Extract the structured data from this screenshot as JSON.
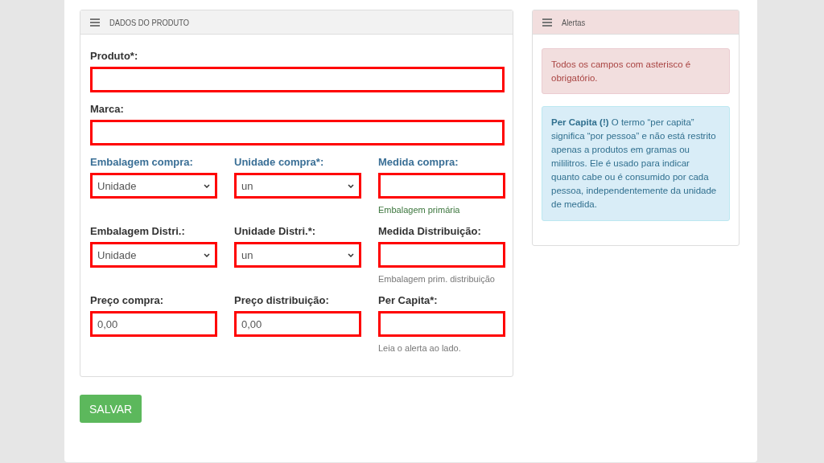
{
  "product_panel": {
    "title": "DADOS DO PRODUTO",
    "rows": [
      {
        "fields": [
          {
            "label": "Produto*:",
            "kind": "input",
            "highlighted": false,
            "invalid": true
          }
        ]
      },
      {
        "fields": [
          {
            "label": "Marca:",
            "kind": "input",
            "highlighted": false,
            "invalid": true
          }
        ]
      },
      {
        "fields": [
          {
            "label": "Embalagem compra:",
            "kind": "select",
            "value": "Unidade",
            "highlighted": true,
            "invalid": true
          },
          {
            "label": "Unidade compra*:",
            "kind": "select",
            "value": "un",
            "highlighted": true,
            "invalid": true
          },
          {
            "label": "Medida compra:",
            "kind": "input",
            "highlighted": true,
            "invalid": true,
            "help": {
              "text": "Embalagem primária",
              "color": "#3c763d"
            }
          }
        ]
      },
      {
        "fields": [
          {
            "label": "Embalagem Distri.:",
            "kind": "select",
            "value": "Unidade",
            "highlighted": false,
            "invalid": true
          },
          {
            "label": "Unidade Distri.*:",
            "kind": "select",
            "value": "un",
            "highlighted": false,
            "invalid": true
          },
          {
            "label": "Medida Distribuição:",
            "kind": "input",
            "highlighted": false,
            "invalid": true,
            "help": {
              "text": "Embalagem prim. distribuição",
              "color": "#777777"
            }
          }
        ]
      },
      {
        "fields": [
          {
            "label": "Preço compra:",
            "kind": "input",
            "value": "0,00",
            "highlighted": false,
            "invalid": true
          },
          {
            "label": "Preço distribuição:",
            "kind": "input",
            "value": "0,00",
            "highlighted": false,
            "invalid": true
          },
          {
            "label": "Per Capita*:",
            "kind": "input",
            "highlighted": false,
            "invalid": true,
            "help": {
              "text": "Leia o alerta ao lado.",
              "color": "#777777"
            }
          }
        ]
      }
    ]
  },
  "save_button": "SALVAR",
  "alerts_panel": {
    "title": "Alertas",
    "alerts": [
      {
        "kind": "danger",
        "text": "Todos os campos com asterisco é obrigatório."
      },
      {
        "kind": "info",
        "text": "**Per Capita (!)** O termo “per capita” significa “por pessoa” e não está restrito apenas a produtos em gramas ou mililitros. Ele é usado para indicar quanto cabe ou é consumido por cada pessoa, independentemente da unidade de medida."
      }
    ]
  }
}
